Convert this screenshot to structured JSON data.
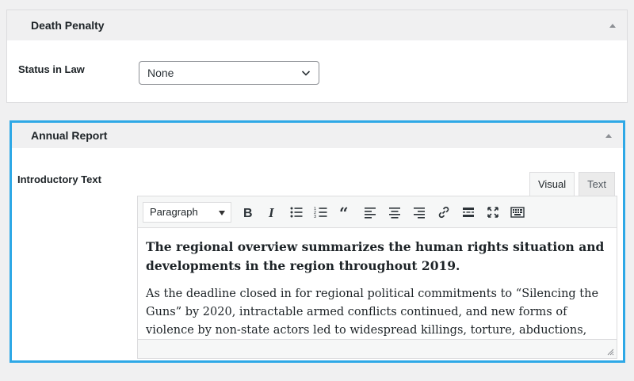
{
  "death_penalty": {
    "title": "Death Penalty",
    "status_label": "Status in Law",
    "status_value": "None"
  },
  "annual_report": {
    "title": "Annual Report",
    "intro_label": "Introductory Text",
    "tabs": [
      {
        "label": "Visual",
        "active": true
      },
      {
        "label": "Text",
        "active": false
      }
    ],
    "format_value": "Paragraph",
    "content": {
      "lead": "The regional overview summarizes the human rights situation and developments in the region throughout 2019.",
      "paragraph": "As the deadline closed in for regional political commitments to “Silencing the Guns” by 2020, intractable armed conflicts continued, and new forms of violence by non-state actors led to widespread killings, torture, abductions, sexual violence and mass"
    }
  },
  "toolbar_icons": [
    "bold-icon",
    "italic-icon",
    "bullet-list-icon",
    "numbered-list-icon",
    "blockquote-icon",
    "align-left-icon",
    "align-center-icon",
    "align-right-icon",
    "link-icon",
    "read-more-icon",
    "fullscreen-icon",
    "toolbar-toggle-icon"
  ],
  "colors": {
    "highlight": "#2ea8e6",
    "panel_header_bg": "#f0f0f1",
    "border": "#dcdcde"
  }
}
